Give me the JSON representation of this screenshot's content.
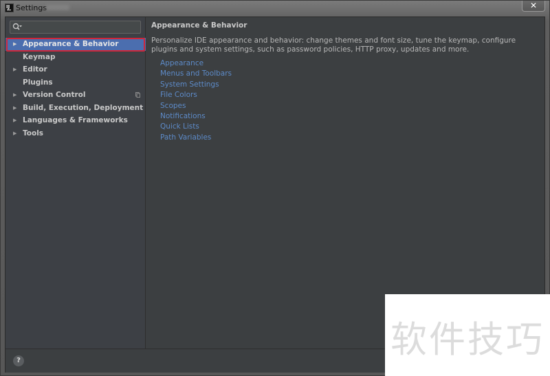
{
  "window": {
    "title": "Settings",
    "close_glyph": "✕"
  },
  "search": {
    "placeholder": "",
    "value": ""
  },
  "sidebar": {
    "items": [
      {
        "label": "Appearance & Behavior",
        "expandable": true,
        "selected": true
      },
      {
        "label": "Keymap",
        "expandable": false,
        "selected": false
      },
      {
        "label": "Editor",
        "expandable": true,
        "selected": false
      },
      {
        "label": "Plugins",
        "expandable": false,
        "selected": false
      },
      {
        "label": "Version Control",
        "expandable": true,
        "selected": false,
        "project_icon": true
      },
      {
        "label": "Build, Execution, Deployment",
        "expandable": true,
        "selected": false
      },
      {
        "label": "Languages & Frameworks",
        "expandable": true,
        "selected": false
      },
      {
        "label": "Tools",
        "expandable": true,
        "selected": false
      }
    ],
    "arrow_glyph": "▶"
  },
  "content": {
    "title": "Appearance & Behavior",
    "description": "Personalize IDE appearance and behavior: change themes and font size, tune the keymap, configure plugins and system settings, such as password policies, HTTP proxy, updates and more.",
    "links": [
      "Appearance",
      "Menus and Toolbars",
      "System Settings",
      "File Colors",
      "Scopes",
      "Notifications",
      "Quick Lists",
      "Path Variables"
    ]
  },
  "footer": {
    "help_label": "?"
  },
  "watermark": {
    "text": "软件技巧"
  },
  "colors": {
    "selection": "#4b6eaf",
    "highlight_border": "#d0263a",
    "link": "#5d8bc9",
    "background": "#3c3f41"
  }
}
